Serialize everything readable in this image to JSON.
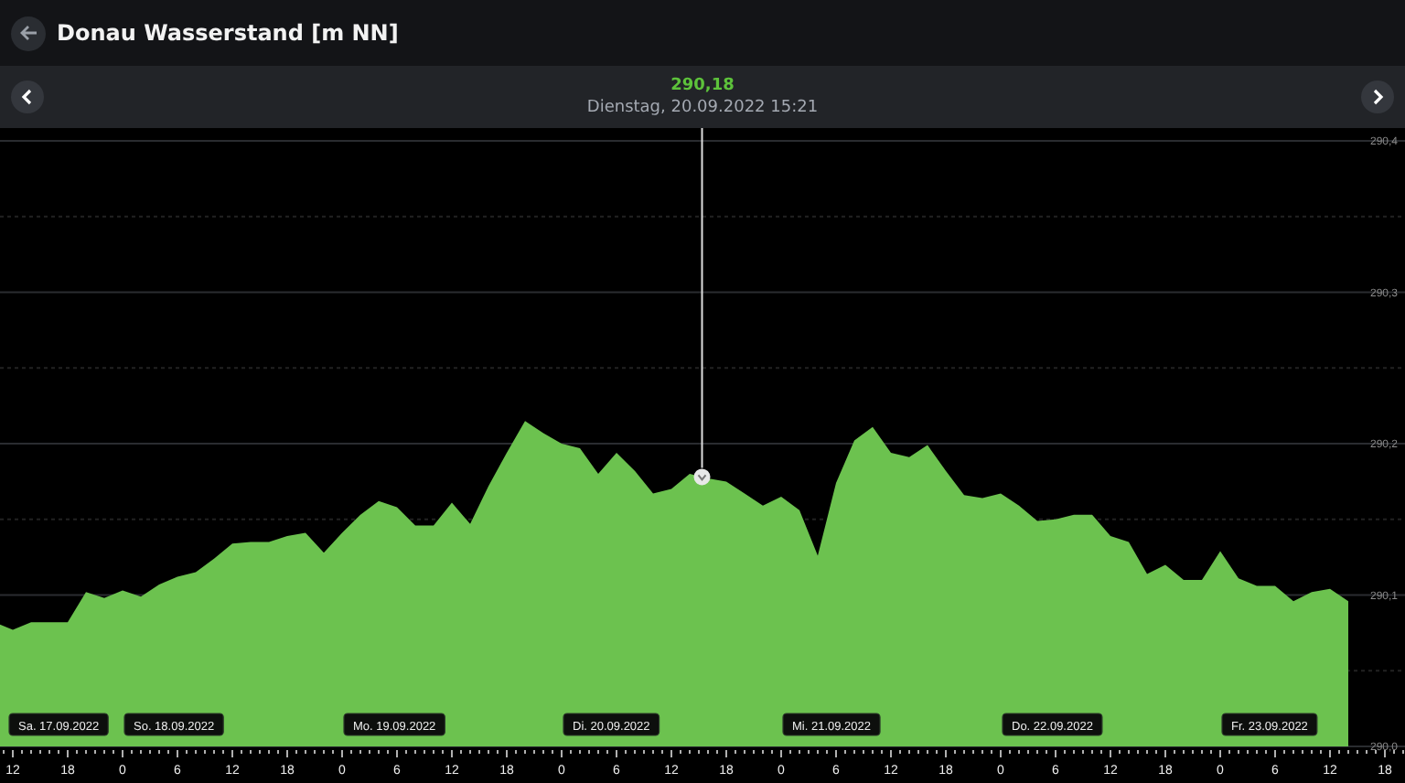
{
  "header": {
    "title": "Donau Wasserstand [m NN]"
  },
  "navigator": {
    "value": "290,18",
    "timestamp": "Dienstag, 20.09.2022 15:21"
  },
  "chart": {
    "day_labels": [
      "Sa. 17.09.2022",
      "So. 18.09.2022",
      "Mo. 19.09.2022",
      "Di. 20.09.2022",
      "Mi. 21.09.2022",
      "Do. 22.09.2022",
      "Fr. 23.09.2022"
    ],
    "chart_data": {
      "type": "area",
      "grid": true,
      "categories": [
        null,
        "12",
        null,
        null,
        "18",
        null,
        null,
        "0",
        null,
        null,
        "6",
        null,
        null,
        "12",
        null,
        null,
        "18",
        null,
        null,
        "0",
        null,
        null,
        "6",
        null,
        null,
        "12",
        null,
        null,
        "18",
        null,
        null,
        "0",
        null,
        null,
        "6",
        null,
        null,
        "12",
        null,
        null,
        "18",
        null,
        null,
        "0",
        null,
        null,
        "6",
        null,
        null,
        "12",
        null,
        null,
        "18",
        null,
        null,
        "0",
        null,
        null,
        "6",
        null,
        null,
        "12",
        null,
        null,
        "18",
        null,
        null,
        "0",
        null,
        null,
        "6",
        null,
        null,
        "12",
        null,
        null,
        "18",
        null
      ],
      "series": [
        {
          "color": "#6cc24f",
          "values": [
            290.082,
            290.077,
            290.082,
            290.082,
            290.082,
            290.102,
            290.098,
            290.103,
            290.099,
            290.107,
            290.112,
            290.115,
            290.124,
            290.134,
            290.135,
            290.135,
            290.139,
            290.141,
            290.128,
            290.141,
            290.153,
            290.162,
            290.158,
            290.146,
            290.146,
            290.161,
            290.147,
            290.172,
            290.194,
            290.215,
            290.207,
            290.2,
            290.197,
            290.18,
            290.194,
            290.182,
            290.167,
            290.17,
            290.18,
            290.177,
            290.175,
            290.167,
            290.159,
            290.165,
            290.156,
            290.126,
            290.174,
            290.202,
            290.211,
            290.194,
            290.191,
            290.199,
            290.182,
            290.166,
            290.164,
            290.167,
            290.159,
            290.149,
            290.15,
            290.153,
            290.153,
            290.139,
            290.135,
            290.114,
            290.12,
            290.11,
            290.11,
            290.129,
            290.111,
            290.106,
            290.106,
            290.096,
            290.102,
            290.104,
            290.096,
            null,
            null,
            null
          ]
        }
      ],
      "ylim": [
        290,
        290.4
      ],
      "yticks": [
        {
          "value": 290,
          "label": "290,0"
        },
        {
          "value": 290.1,
          "label": "290,1"
        },
        {
          "value": 290.2,
          "label": "290,2"
        },
        {
          "value": 290.3,
          "label": "290,3"
        },
        {
          "value": 290.4,
          "label": "290,4"
        }
      ]
    }
  }
}
